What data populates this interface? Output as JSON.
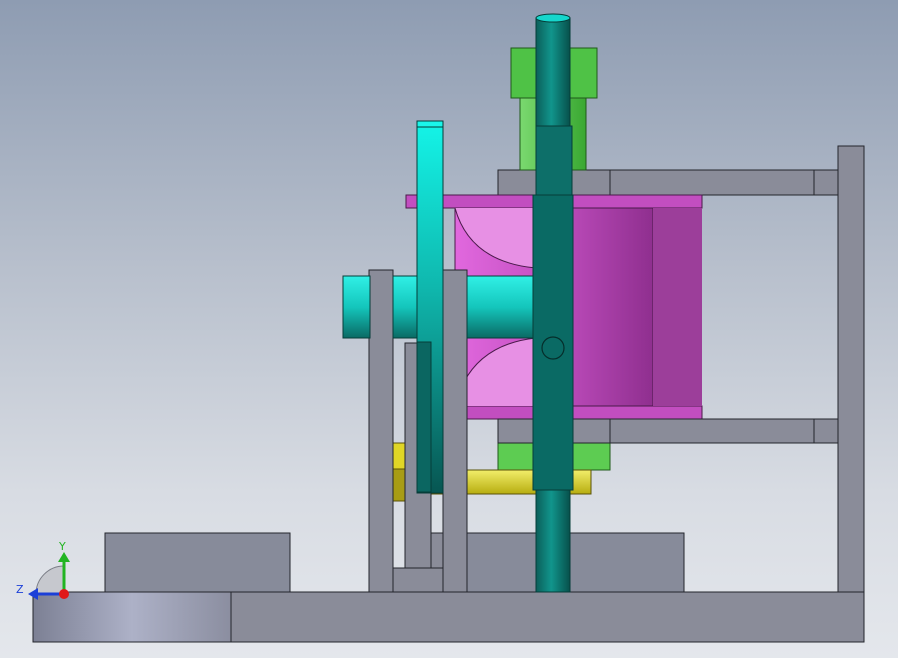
{
  "viewport": {
    "background_top": "#8e9cb2",
    "background_bottom": "#e4e7ec"
  },
  "triad": {
    "x_label": "",
    "y_label": "Y",
    "z_label": "Z",
    "y_color": "#22b422",
    "z_color": "#1b3fd8",
    "origin_color": "#e01818"
  },
  "materials": {
    "frame_gray": "#8a8c99",
    "edge": "#23252c",
    "teal": "#0e7f78",
    "teal_light": "#12e8dc",
    "magenta": "#c24ec0",
    "green": "#4fc246",
    "yellow": "#e0d626"
  }
}
